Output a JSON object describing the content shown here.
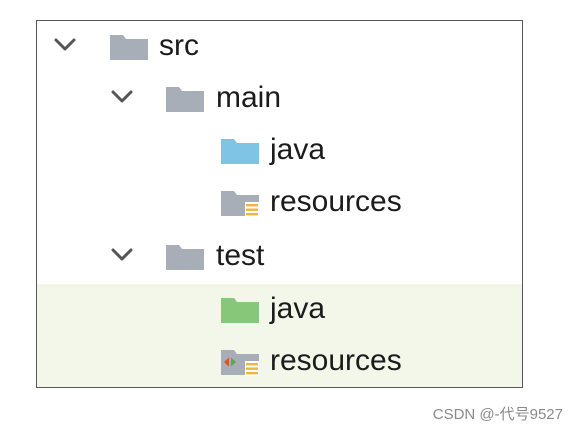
{
  "tree": {
    "src": {
      "label": "src",
      "icon": "folder-icon",
      "expanded": true
    },
    "main": {
      "label": "main",
      "icon": "folder-icon",
      "expanded": true
    },
    "main_java": {
      "label": "java",
      "icon": "source-root-folder-icon",
      "color": "#7fc4e4"
    },
    "main_resources": {
      "label": "resources",
      "icon": "resources-root-folder-icon"
    },
    "test": {
      "label": "test",
      "icon": "folder-icon",
      "expanded": true
    },
    "test_java": {
      "label": "java",
      "icon": "test-source-root-folder-icon",
      "color": "#86c77a"
    },
    "test_resources": {
      "label": "resources",
      "icon": "test-resources-root-folder-icon"
    }
  },
  "colors": {
    "folder_gray": "#a7aeb7",
    "source_blue": "#7fc4e4",
    "test_green": "#86c77a",
    "resources_bars": "#f0b53c",
    "test_row_bg": "#f2f7ea"
  },
  "watermark": "CSDN @-代号9527"
}
